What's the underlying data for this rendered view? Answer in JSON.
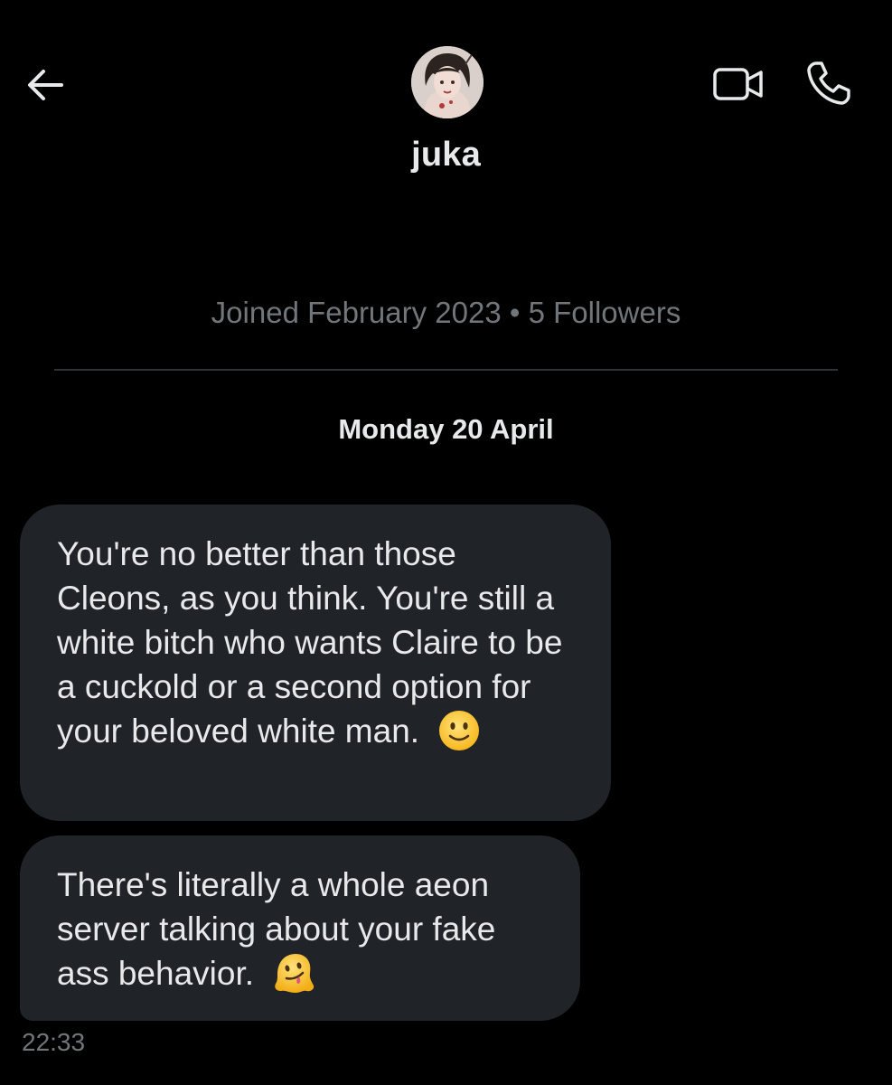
{
  "header": {
    "back_icon": "arrow-left-icon",
    "contact_name": "juka",
    "avatar_description": "avatar",
    "video_icon": "video-camera-icon",
    "call_icon": "phone-icon"
  },
  "profile": {
    "meta": "Joined February 2023 • 5 Followers"
  },
  "conversation": {
    "date_header": "Monday 20 April",
    "messages": [
      {
        "text": "You're no better than those Cleons, as you think. You're still a white bitch who wants Claire to be a cuckold or a second option for your beloved white man.",
        "emoji": "slightly-smiling-face-emoji"
      },
      {
        "text": "There's literally a whole aeon server talking about your fake ass behavior.",
        "emoji": "melting-face-emoji"
      }
    ],
    "timestamp": "22:33"
  },
  "colors": {
    "background": "#000000",
    "bubble": "#202327",
    "primary_text": "#e7e9ea",
    "secondary_text": "#71767b",
    "divider": "#2f3336"
  }
}
